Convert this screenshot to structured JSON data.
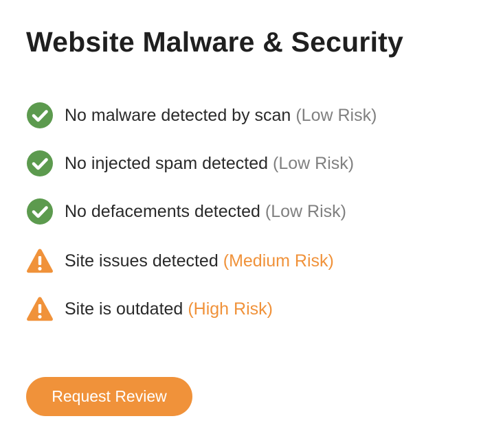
{
  "header": {
    "title": "Website Malware & Security"
  },
  "colors": {
    "pass": "#5c9a4e",
    "warn": "#f0923a",
    "low_risk_text": "#808080",
    "elevated_risk_text": "#f0923a",
    "button_bg": "#f0923a"
  },
  "checks": [
    {
      "icon": "check-circle-icon",
      "status": "pass",
      "text": "No malware detected by scan",
      "risk": "(Low Risk)"
    },
    {
      "icon": "check-circle-icon",
      "status": "pass",
      "text": "No injected spam detected",
      "risk": "(Low Risk)"
    },
    {
      "icon": "check-circle-icon",
      "status": "pass",
      "text": "No defacements detected",
      "risk": "(Low Risk)"
    },
    {
      "icon": "warning-triangle-icon",
      "status": "warn",
      "text": "Site issues detected",
      "risk": "(Medium Risk)"
    },
    {
      "icon": "warning-triangle-icon",
      "status": "warn",
      "text": "Site is outdated",
      "risk": "(High Risk)"
    }
  ],
  "actions": {
    "request_review_label": "Request Review"
  }
}
